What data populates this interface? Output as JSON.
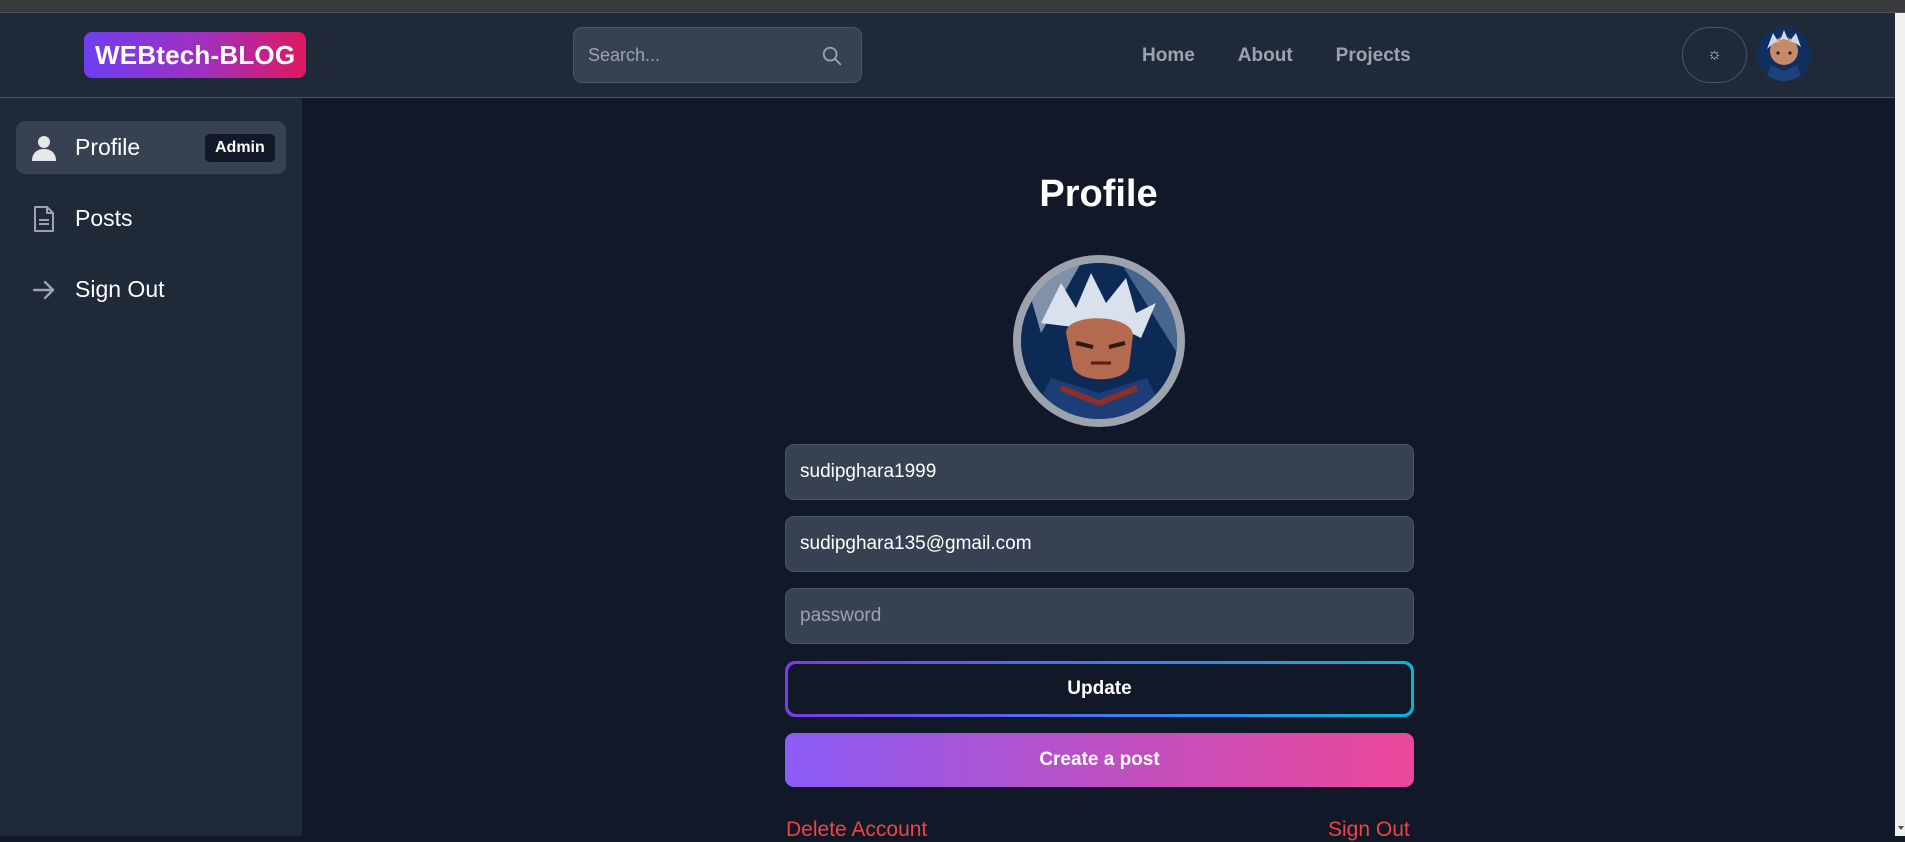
{
  "navbar": {
    "logo": "WEBtech-BLOG",
    "search_placeholder": "Search...",
    "links": [
      "Home",
      "About",
      "Projects"
    ],
    "theme_toggle_glyph": "☼"
  },
  "sidebar": {
    "items": [
      {
        "label": "Profile",
        "icon": "user-icon",
        "badge": "Admin",
        "active": true
      },
      {
        "label": "Posts",
        "icon": "document-icon",
        "active": false
      },
      {
        "label": "Sign Out",
        "icon": "arrow-right-icon",
        "active": false
      }
    ]
  },
  "profile": {
    "title": "Profile",
    "username": "sudipghara1999",
    "email": "sudipghara135@gmail.com",
    "password_placeholder": "password",
    "update_label": "Update",
    "create_post_label": "Create a post",
    "delete_account_label": "Delete Account",
    "sign_out_label": "Sign Out"
  },
  "colors": {
    "background": "#111827",
    "panel": "#1f2937",
    "input": "#374151",
    "danger": "#ef4444",
    "accent_purple": "#8b5cf6",
    "accent_pink": "#ec4899"
  }
}
